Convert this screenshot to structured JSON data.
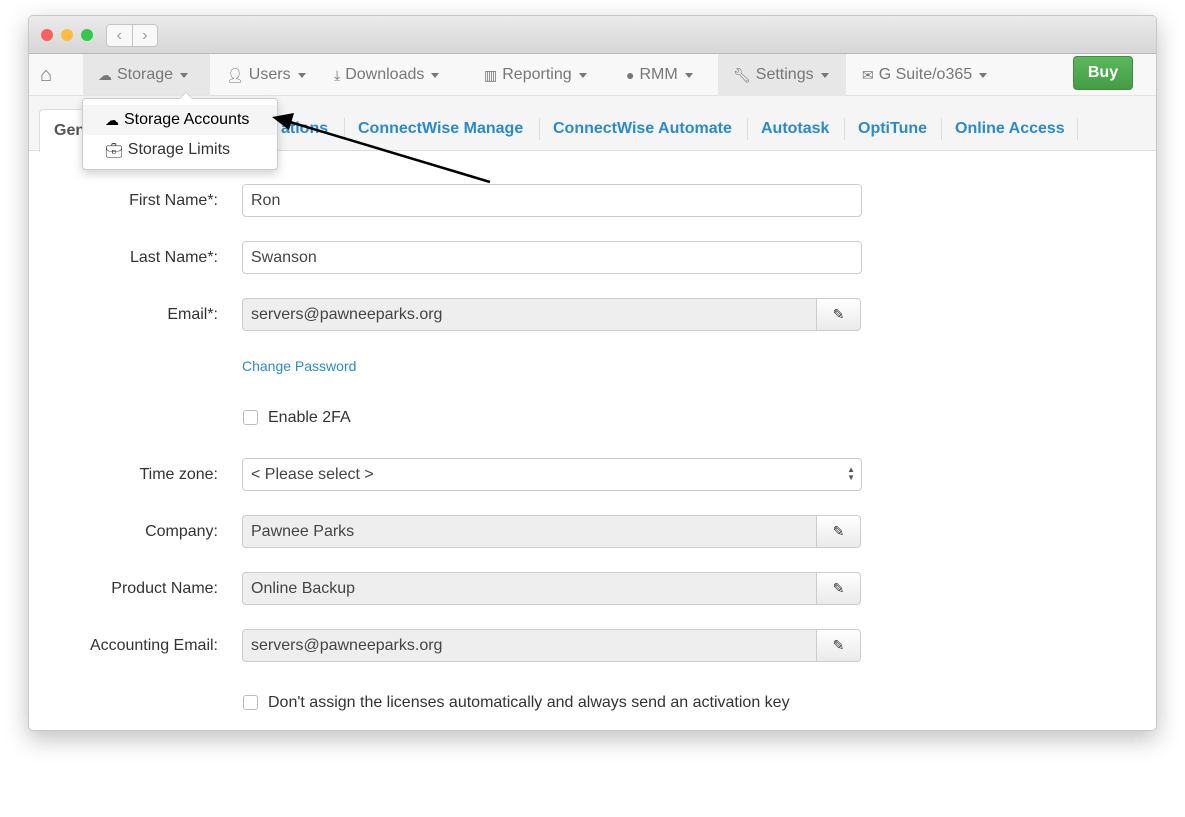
{
  "window": {
    "controls": {
      "close": "#fc605c",
      "minimize": "#fdbc40",
      "zoom": "#34c84a"
    },
    "back_icon": "‹",
    "forward_icon": "›"
  },
  "navbar": {
    "home_icon": "home-icon",
    "items": [
      {
        "label": "Storage",
        "icon": "cloud-icon"
      },
      {
        "label": "Users",
        "icon": "user-icon"
      },
      {
        "label": "Downloads",
        "icon": "download-icon"
      },
      {
        "label": "Reporting",
        "icon": "bar-chart-icon"
      },
      {
        "label": "RMM",
        "icon": "globe-icon"
      },
      {
        "label": "Settings",
        "icon": "wrench-icon"
      },
      {
        "label": "G Suite/o365",
        "icon": "envelope-icon"
      }
    ],
    "buy_label": "Buy",
    "buy_color": "#5cb85c"
  },
  "storage_dropdown": {
    "items": [
      {
        "label": "Storage Accounts",
        "icon": "cloud-icon"
      },
      {
        "label": "Storage Limits",
        "icon": "briefcase-icon"
      }
    ]
  },
  "tabs": {
    "items": [
      "Gen",
      "ations",
      "ConnectWise Manage",
      "ConnectWise Automate",
      "Autotask",
      "OptiTune",
      "Online Access"
    ],
    "link_color": "#2a8ad0"
  },
  "form": {
    "first_name": {
      "label": "First Name*:",
      "value": "Ron"
    },
    "last_name": {
      "label": "Last Name*:",
      "value": "Swanson"
    },
    "email": {
      "label": "Email*:",
      "value": "servers@pawneeparks.org"
    },
    "change_password": "Change Password",
    "enable_2fa": {
      "label": "Enable 2FA",
      "checked": false
    },
    "time_zone": {
      "label": "Time zone:",
      "value": "< Please select >"
    },
    "company": {
      "label": "Company:",
      "value": "Pawnee Parks"
    },
    "product_name": {
      "label": "Product Name:",
      "value": "Online Backup"
    },
    "accounting_email": {
      "label": "Accounting Email:",
      "value": "servers@pawneeparks.org"
    },
    "no_auto_assign": {
      "label": "Don't assign the licenses automatically and always send an activation key",
      "checked": false
    }
  }
}
